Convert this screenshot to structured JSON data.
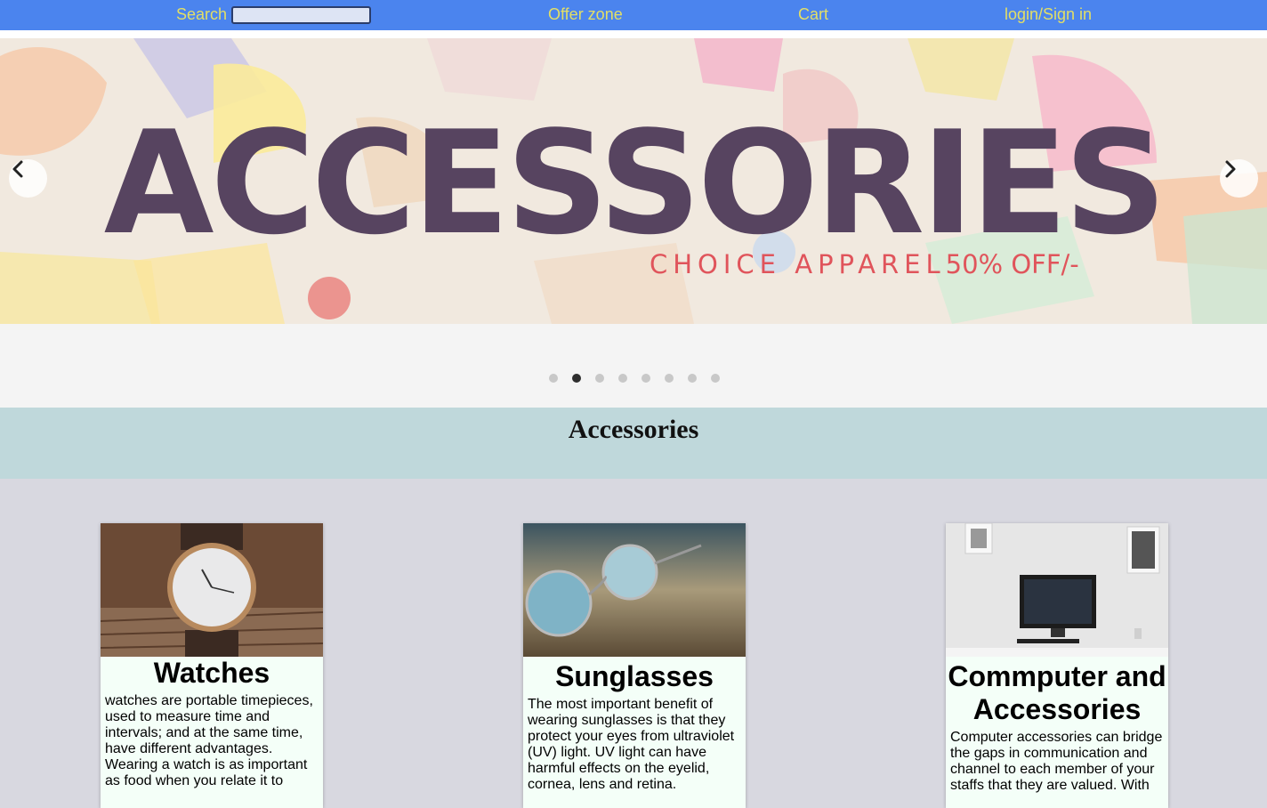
{
  "nav": {
    "search_label": "Search",
    "search_value": "",
    "offer_label": "Offer zone",
    "cart_label": "Cart",
    "login_label": "login/Sign in"
  },
  "hero": {
    "headline": "ACCESSORIES",
    "subline": "CHOICE APPAREL",
    "offer": "50% OFF/-",
    "slide_count": 8,
    "active_slide": 2
  },
  "section": {
    "title": "Accessories"
  },
  "cards": [
    {
      "title": "Watches",
      "image": "watch-photo",
      "text": "watches are portable timepieces, used to measure time and intervals; and at the same time, have different advantages. Wearing a watch is as important as food when you relate it to"
    },
    {
      "title": "Sunglasses",
      "image": "sunglasses-photo",
      "text": "The most important benefit of wearing sunglasses is that they protect your eyes from ultraviolet (UV) light. UV light can have harmful effects on the eyelid, cornea, lens and retina."
    },
    {
      "title": "Commputer and Accessories",
      "image": "computer-desk-photo",
      "text": "Computer accessories can bridge the gaps in communication and channel to each member of your staffs that they are valued. With"
    }
  ],
  "colors": {
    "nav_bg": "#4b84ee",
    "nav_text": "#e3df66",
    "headline": "#574460",
    "subline": "#e0545b",
    "title_band": "#bfd8db",
    "page_bg": "#d8d8e0",
    "card_bg": "#f4fff8"
  },
  "icons": {
    "prev": "chevron-left-icon",
    "next": "chevron-right-icon"
  }
}
